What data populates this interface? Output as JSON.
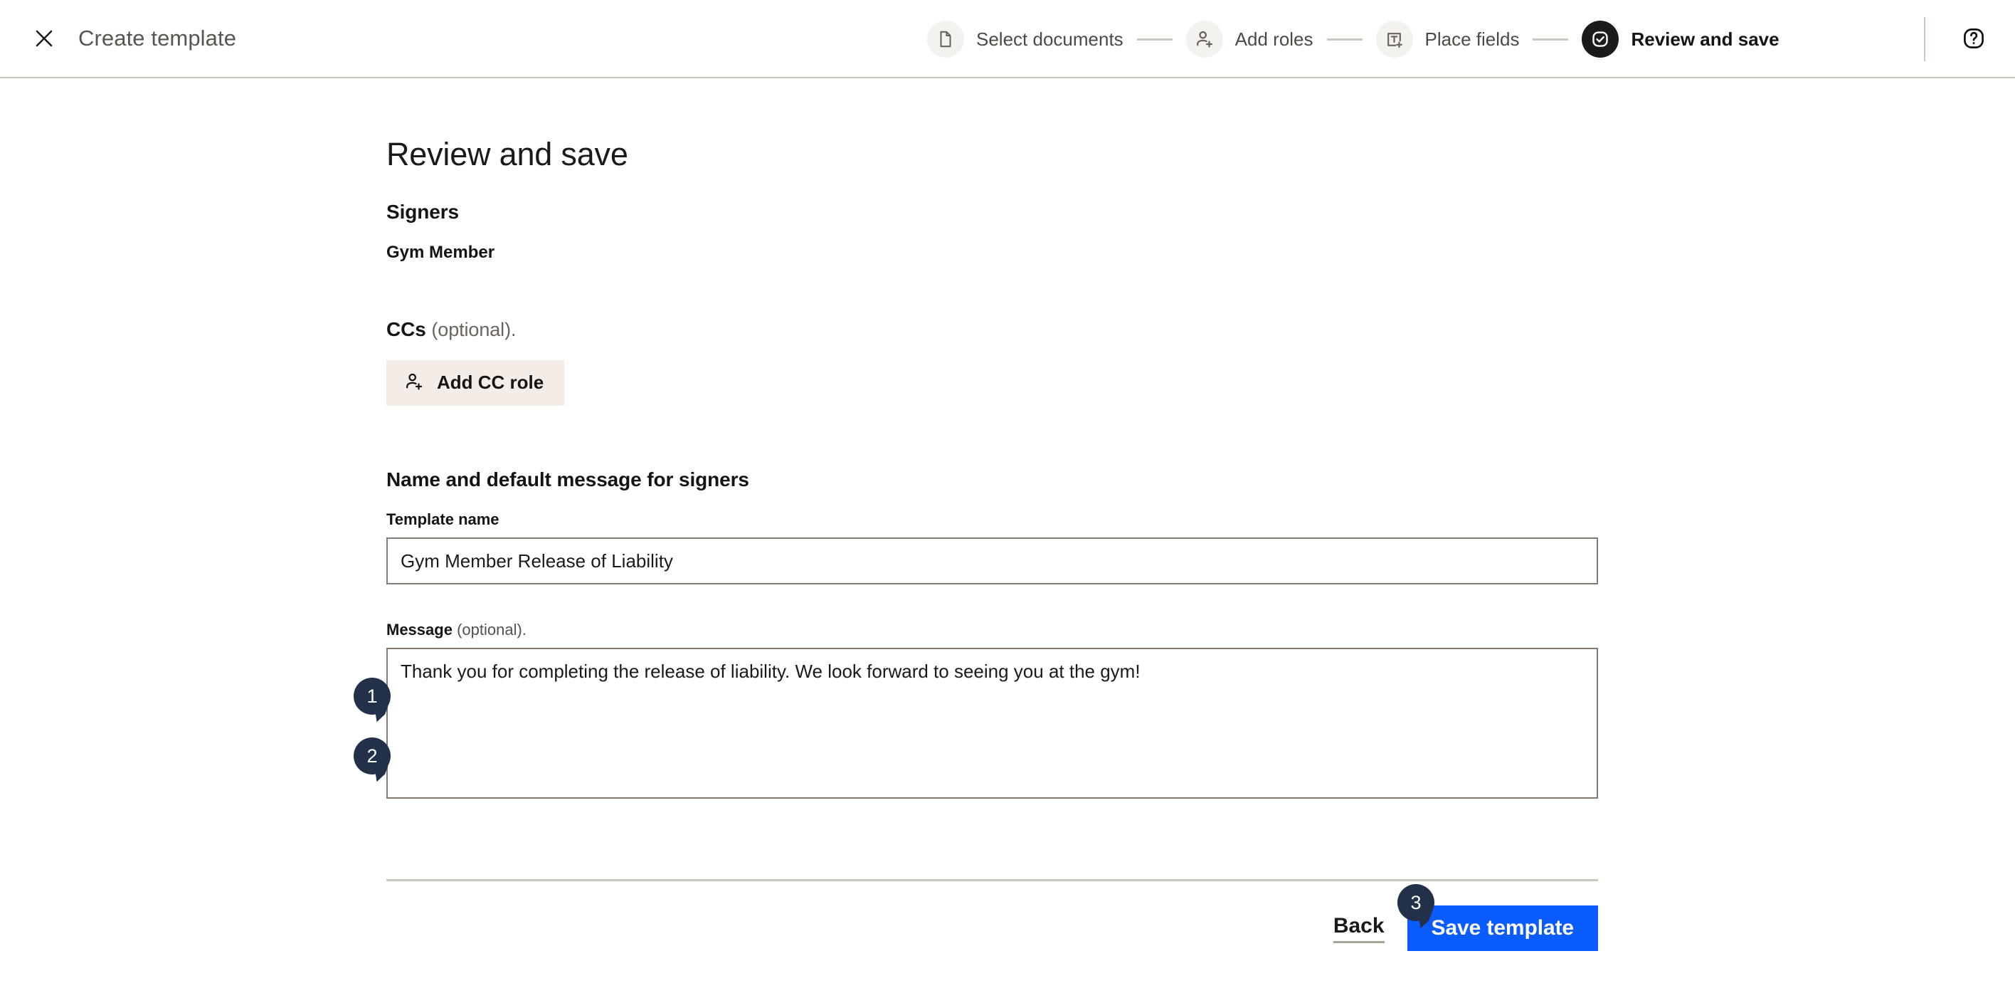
{
  "header": {
    "close_icon": "close-icon",
    "title": "Create template",
    "help_icon": "help-circle-icon",
    "steps": [
      {
        "label": "Select documents",
        "icon": "document-icon",
        "active": false
      },
      {
        "label": "Add roles",
        "icon": "person-add-icon",
        "active": false
      },
      {
        "label": "Place fields",
        "icon": "text-field-add-icon",
        "active": false
      },
      {
        "label": "Review and save",
        "icon": "check-circle-icon",
        "active": true
      }
    ]
  },
  "main": {
    "page_title": "Review and save",
    "signers": {
      "heading": "Signers",
      "roles": [
        "Gym Member"
      ]
    },
    "ccs": {
      "heading": "CCs",
      "optional": "(optional).",
      "add_button_label": "Add CC role",
      "add_button_icon": "person-add-icon"
    },
    "name_message": {
      "heading": "Name and default message for signers",
      "template_name": {
        "label": "Template name",
        "value": "Gym Member Release of Liability",
        "placeholder": ""
      },
      "message": {
        "label": "Message",
        "optional": "(optional).",
        "value": "Thank you for completing the release of liability. We look forward to seeing you at the gym!",
        "placeholder": ""
      }
    },
    "footer": {
      "back_label": "Back",
      "save_label": "Save template"
    }
  },
  "markers": [
    {
      "number": "1",
      "target": "template-name-input"
    },
    {
      "number": "2",
      "target": "message-textarea"
    },
    {
      "number": "3",
      "target": "save-template-button"
    }
  ],
  "colors": {
    "accent_blue": "#0a5cff",
    "marker_navy": "#22304a",
    "active_step": "#1b1b1b",
    "border_taupe": "#857a72",
    "divider_taupe": "#cdc7bf",
    "cc_button_bg": "#f4ece7",
    "step_badge_bg": "#f4f2ee"
  }
}
